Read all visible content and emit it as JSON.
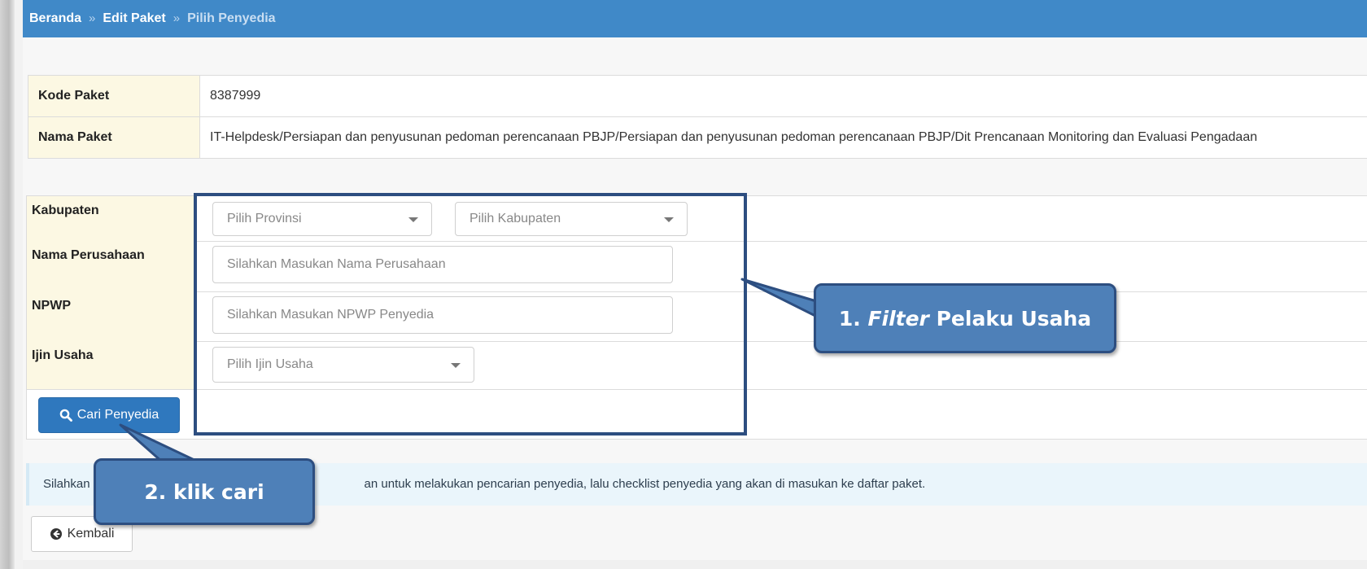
{
  "breadcrumb": {
    "home": "Beranda",
    "separator": "»",
    "edit_paket": "Edit Paket",
    "current": "Pilih Penyedia"
  },
  "paket_info": [
    {
      "label": "Kode Paket",
      "value": "8387999"
    },
    {
      "label": "Nama Paket",
      "value": "IT-Helpdesk/Persiapan dan penyusunan pedoman perencanaan PBJP/Persiapan dan penyusunan pedoman perencanaan PBJP/Dit Prencanaan Monitoring dan Evaluasi Pengadaan"
    }
  ],
  "filter": {
    "kabupaten_label": "Kabupaten",
    "provinsi_placeholder": "Pilih Provinsi",
    "kabupaten_placeholder": "Pilih Kabupaten",
    "nama_perusahaan_label": "Nama Perusahaan",
    "nama_perusahaan_placeholder": "Silahkan Masukan Nama Perusahaan",
    "npwp_label": "NPWP",
    "npwp_placeholder": "Silahkan Masukan NPWP Penyedia",
    "ijin_usaha_label": "Ijin Usaha",
    "ijin_usaha_placeholder": "Pilih Ijin Usaha",
    "search_button": "Cari Penyedia"
  },
  "info_message_start": "Silahkan",
  "info_message_end": "an untuk melakukan pencarian penyedia, lalu checklist penyedia yang akan di masukan ke daftar paket.",
  "back_button": "Kembali",
  "annotations": {
    "callout_1_prefix": "1.",
    "callout_1_italic": "Filter",
    "callout_1_suffix": "Pelaku Usaha",
    "callout_2": "2. klik cari"
  },
  "colors": {
    "topbar": "#4089c8",
    "label_bg": "#fcf8e3",
    "primary_button": "#2f78be",
    "callout_fill": "#4e80b8",
    "callout_border": "#2d4e80"
  }
}
